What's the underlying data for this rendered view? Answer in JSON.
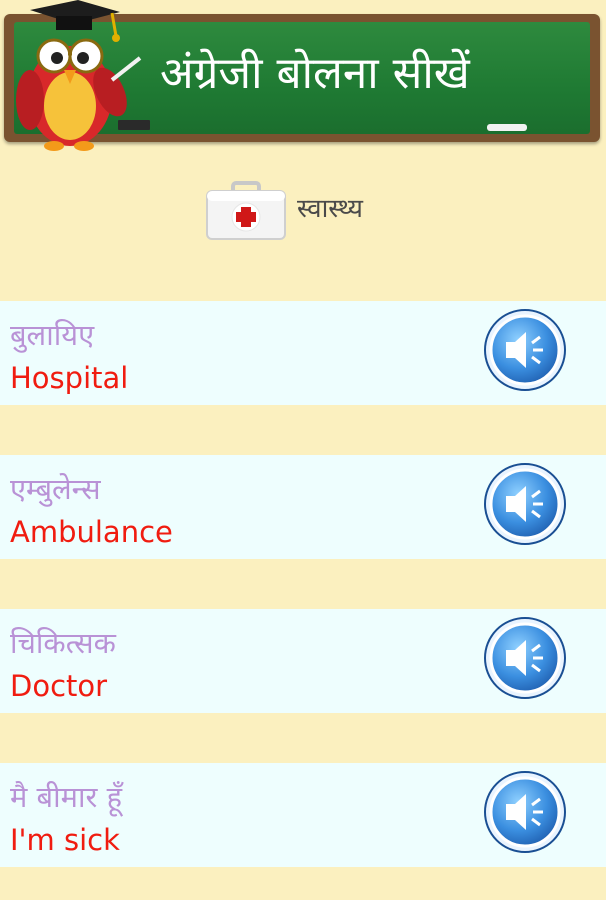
{
  "header": {
    "title": "अंग्रेजी बोलना सीखें"
  },
  "category": {
    "label": "स्वास्थ्य",
    "icon": "first-aid-kit-icon"
  },
  "phrases": [
    {
      "hindi": "बुलायिए",
      "english": "Hospital"
    },
    {
      "hindi": "एम्बुलेन्स",
      "english": "Ambulance"
    },
    {
      "hindi": "चिकित्सक",
      "english": "Doctor"
    },
    {
      "hindi": "मै बीमार हूँ",
      "english": "I'm sick"
    }
  ],
  "colors": {
    "background": "#fbf0bf",
    "row_background": "#eefefe",
    "hindi_text": "#b992d6",
    "english_text": "#f01c10",
    "board_green": "#1f7a33",
    "speaker_blue": "#2f7fd6"
  },
  "icons": {
    "speaker": "speaker-icon",
    "owl": "owl-mascot-icon"
  }
}
